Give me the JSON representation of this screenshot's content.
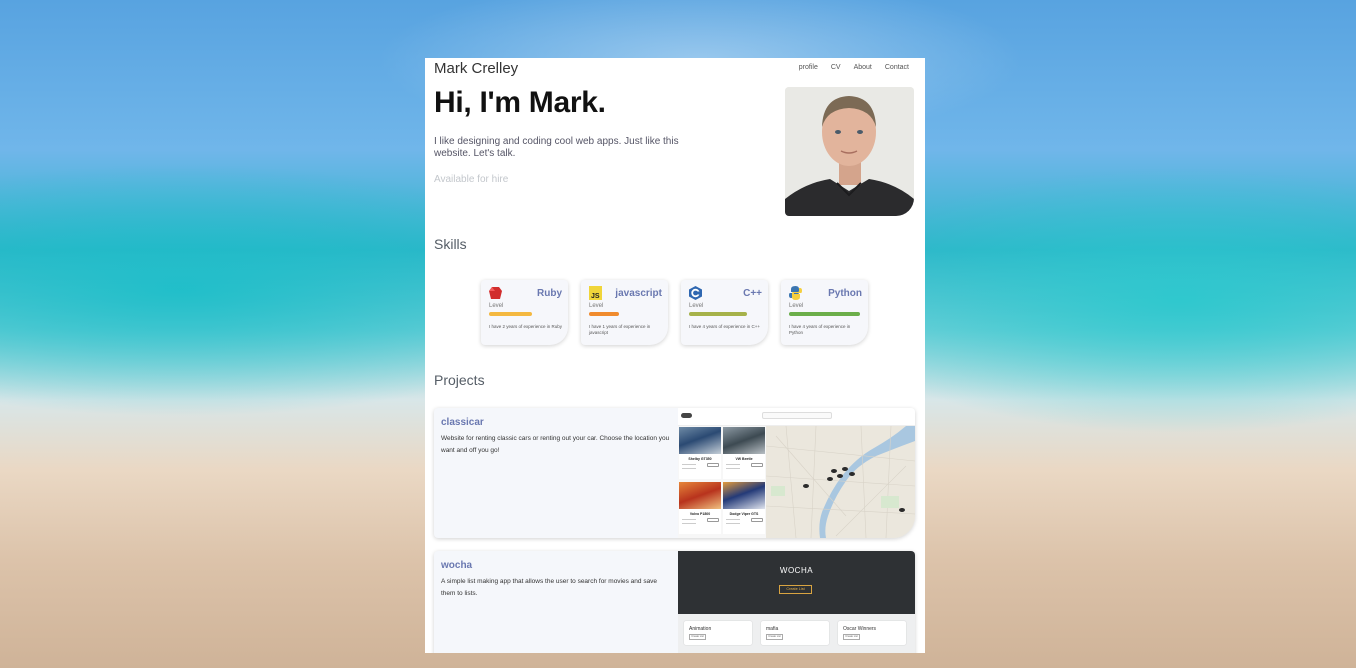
{
  "header": {
    "brand": "Mark Crelley",
    "nav": [
      "profile",
      "CV",
      "About",
      "Contact"
    ]
  },
  "hero": {
    "title": "Hi, I'm Mark.",
    "text": "I like designing and coding cool web apps. Just like this website. Let's talk.",
    "status": "Available for hire"
  },
  "skills": {
    "title": "Skills",
    "level_label": "Level",
    "items": [
      {
        "name": "Ruby",
        "icon": "ruby-icon",
        "color": "#f4b840",
        "level": 0.6,
        "desc": "I have 2 years of experience in Ruby"
      },
      {
        "name": "javascript",
        "icon": "javascript-icon",
        "color": "#f08b2e",
        "level": 0.42,
        "desc": "I have 1 years of experience in javascript"
      },
      {
        "name": "C++",
        "icon": "cpp-icon",
        "color": "#a6b24a",
        "level": 0.82,
        "desc": "I have 4 years of experience in C++"
      },
      {
        "name": "Python",
        "icon": "python-icon",
        "color": "#6bae4a",
        "level": 1.0,
        "desc": "I have 4 years of experience in Python"
      }
    ]
  },
  "projects": {
    "title": "Projects",
    "items": [
      {
        "name": "classicar",
        "desc": "Website for renting classic cars or renting out your car. Choose the location you want and off you go!"
      },
      {
        "name": "wocha",
        "desc": "A simple list making app that allows the user to search for movies and save them to lists."
      }
    ]
  },
  "classicar_shot": {
    "cars": [
      "Shelby GT350",
      "VW Beetle",
      "Volvo P1800",
      "Dodge Viper GTS"
    ]
  },
  "wocha_shot": {
    "title": "WOCHA",
    "button": "Create List",
    "lists": [
      "Animation",
      "mafia",
      "Oscar Winners"
    ],
    "list_button": "Create List"
  }
}
